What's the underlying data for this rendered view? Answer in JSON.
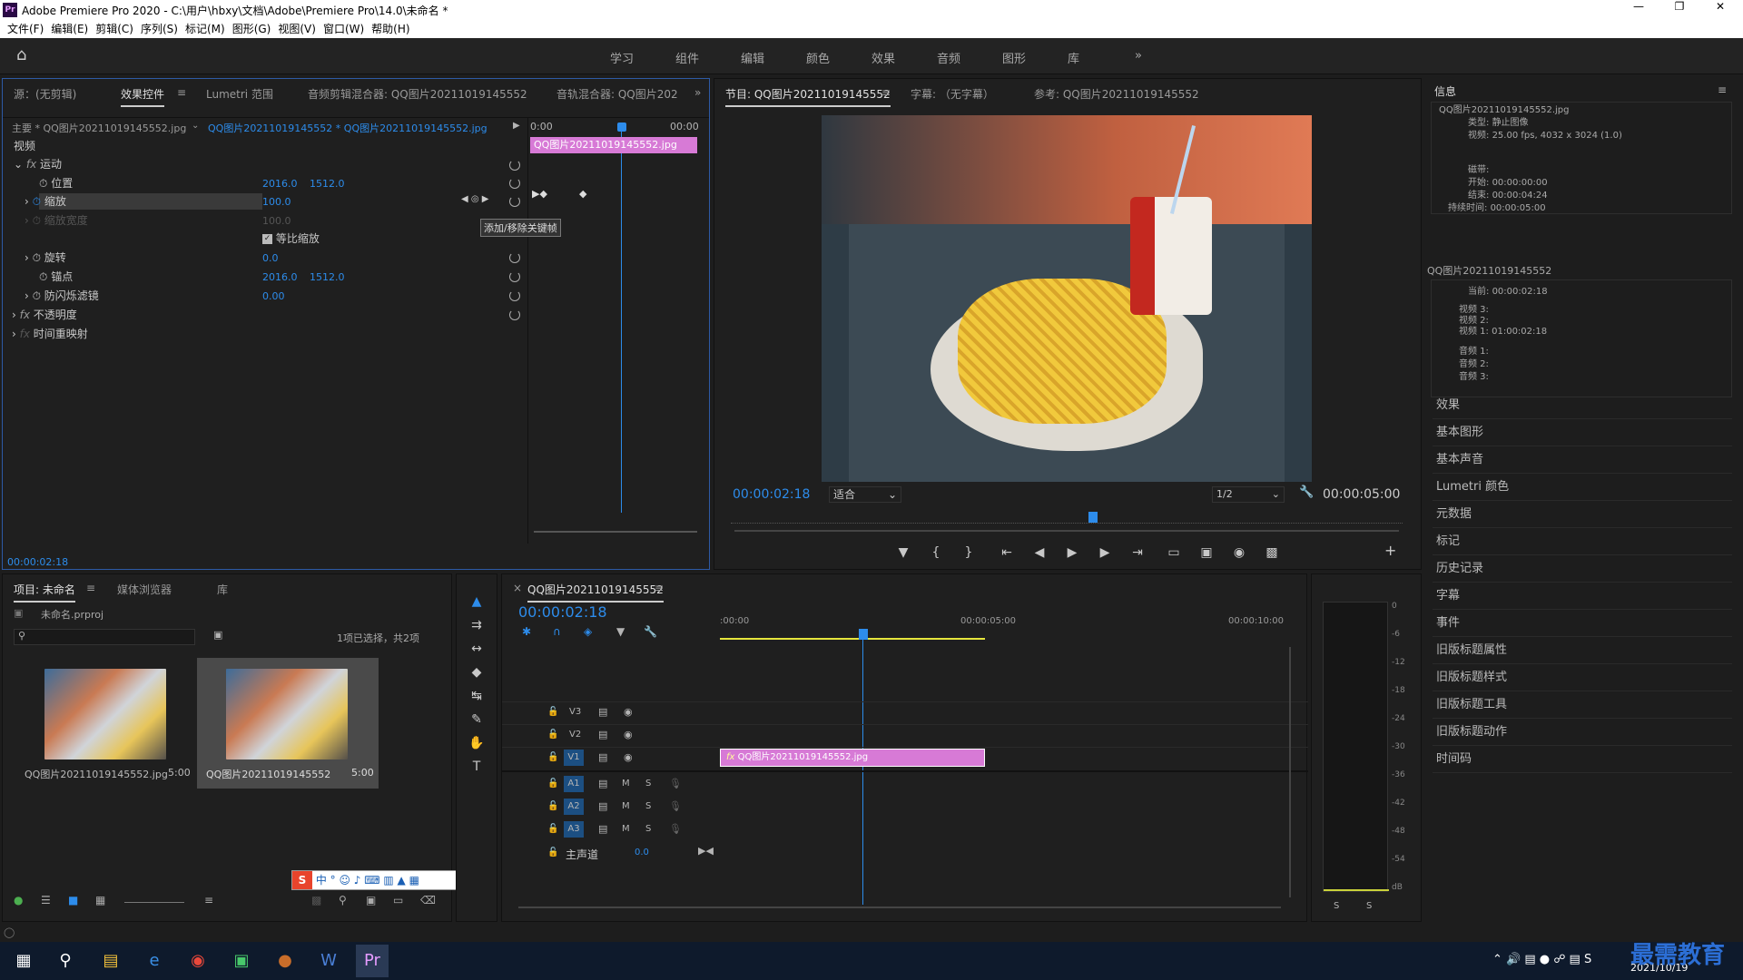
{
  "window": {
    "title": "Adobe Premiere Pro 2020 - C:\\用户\\hbxy\\文档\\Adobe\\Premiere Pro\\14.0\\未命名 *",
    "app_icon": "Pr"
  },
  "menu": [
    "文件(F)",
    "编辑(E)",
    "剪辑(C)",
    "序列(S)",
    "标记(M)",
    "图形(G)",
    "视图(V)",
    "窗口(W)",
    "帮助(H)"
  ],
  "workspaces": [
    "学习",
    "组件",
    "编辑",
    "颜色",
    "效果",
    "音频",
    "图形",
    "库"
  ],
  "effect_panel": {
    "tabs": [
      "源：(无剪辑)",
      "效果控件",
      "Lumetri 范围",
      "音频剪辑混合器: QQ图片20211019145552",
      "音轨混合器: QQ图片202"
    ],
    "master_label": "主要 * QQ图片20211019145552.jpg",
    "sequence_label": "QQ图片20211019145552 * QQ图片20211019145552.jpg",
    "ruler_start": "0:00",
    "ruler_end": "00:00",
    "clip_label": "QQ图片20211019145552.jpg",
    "section_video": "视频",
    "motion": "运动",
    "position": {
      "label": "位置",
      "x": "2016.0",
      "y": "1512.0"
    },
    "scale": {
      "label": "缩放",
      "value": "100.0"
    },
    "scale_width": {
      "label": "缩放宽度",
      "value": "100.0"
    },
    "uniform_scale": "等比缩放",
    "rotation": {
      "label": "旋转",
      "value": "0.0"
    },
    "anchor": {
      "label": "锚点",
      "x": "2016.0",
      "y": "1512.0"
    },
    "flicker": {
      "label": "防闪烁滤镜",
      "value": "0.00"
    },
    "opacity": "不透明度",
    "time_remap": "时间重映射",
    "tooltip": "添加/移除关键帧",
    "timecode": "00:00:02:18"
  },
  "program_monitor": {
    "tabs": [
      "节目: QQ图片20211019145552",
      "字幕: （无字幕）",
      "参考: QQ图片20211019145552"
    ],
    "timecode": "00:00:02:18",
    "fit": "适合",
    "resolution": "1/2",
    "duration": "00:00:05:00"
  },
  "info_panel": {
    "title": "信息",
    "filename": "QQ图片20211019145552.jpg",
    "type_label": "类型:",
    "type_value": "静止图像",
    "video_label": "视频:",
    "video_value": "25.00 fps, 4032 x 3024 (1.0)",
    "tape_label": "磁带:",
    "start_label": "开始:",
    "start_value": "00:00:00:00",
    "end_label": "结束:",
    "end_value": "00:00:04:24",
    "dur_label": "持续时间:",
    "dur_value": "00:00:05:00",
    "seq_name": "QQ图片20211019145552",
    "current_label": "当前:",
    "current_value": "00:00:02:18",
    "v3": "视频 3:",
    "v2": "视频 2:",
    "v1": "视频 1:",
    "v1_value": "01:00:02:18",
    "a1": "音频 1:",
    "a2": "音频 2:",
    "a3": "音频 3:"
  },
  "side_panels": [
    "效果",
    "基本图形",
    "基本声音",
    "Lumetri 颜色",
    "元数据",
    "标记",
    "历史记录",
    "字幕",
    "事件",
    "旧版标题属性",
    "旧版标题样式",
    "旧版标题工具",
    "旧版标题动作",
    "时间码"
  ],
  "project_panel": {
    "tabs": [
      "项目: 未命名",
      "媒体浏览器",
      "库"
    ],
    "project_file": "未命名.prproj",
    "selection": "1项已选择，共2项",
    "items": [
      {
        "name": "QQ图片20211019145552.jpg",
        "duration": "5:00"
      },
      {
        "name": "QQ图片20211019145552",
        "duration": "5:00"
      }
    ]
  },
  "timeline": {
    "tab": "QQ图片20211019145552",
    "timecode": "00:00:02:18",
    "ruler": [
      ":00:00",
      "00:00:05:00",
      "00:00:10:00"
    ],
    "tracks_video": [
      "V3",
      "V2",
      "V1"
    ],
    "tracks_audio": [
      "A1",
      "A2",
      "A3"
    ],
    "m": "M",
    "s": "S",
    "master": "主声道",
    "master_value": "0.0",
    "clip_label": "QQ图片20211019145552.jpg"
  },
  "audio_meter": {
    "scale": [
      "0",
      "-6",
      "-12",
      "-18",
      "-24",
      "-30",
      "-36",
      "-42",
      "-48",
      "-54",
      "dB"
    ],
    "solo": [
      "S",
      "S"
    ]
  },
  "taskbar": {
    "date": "2021/10/19",
    "watermark": "最需教育"
  },
  "ime_toolbar": "中"
}
